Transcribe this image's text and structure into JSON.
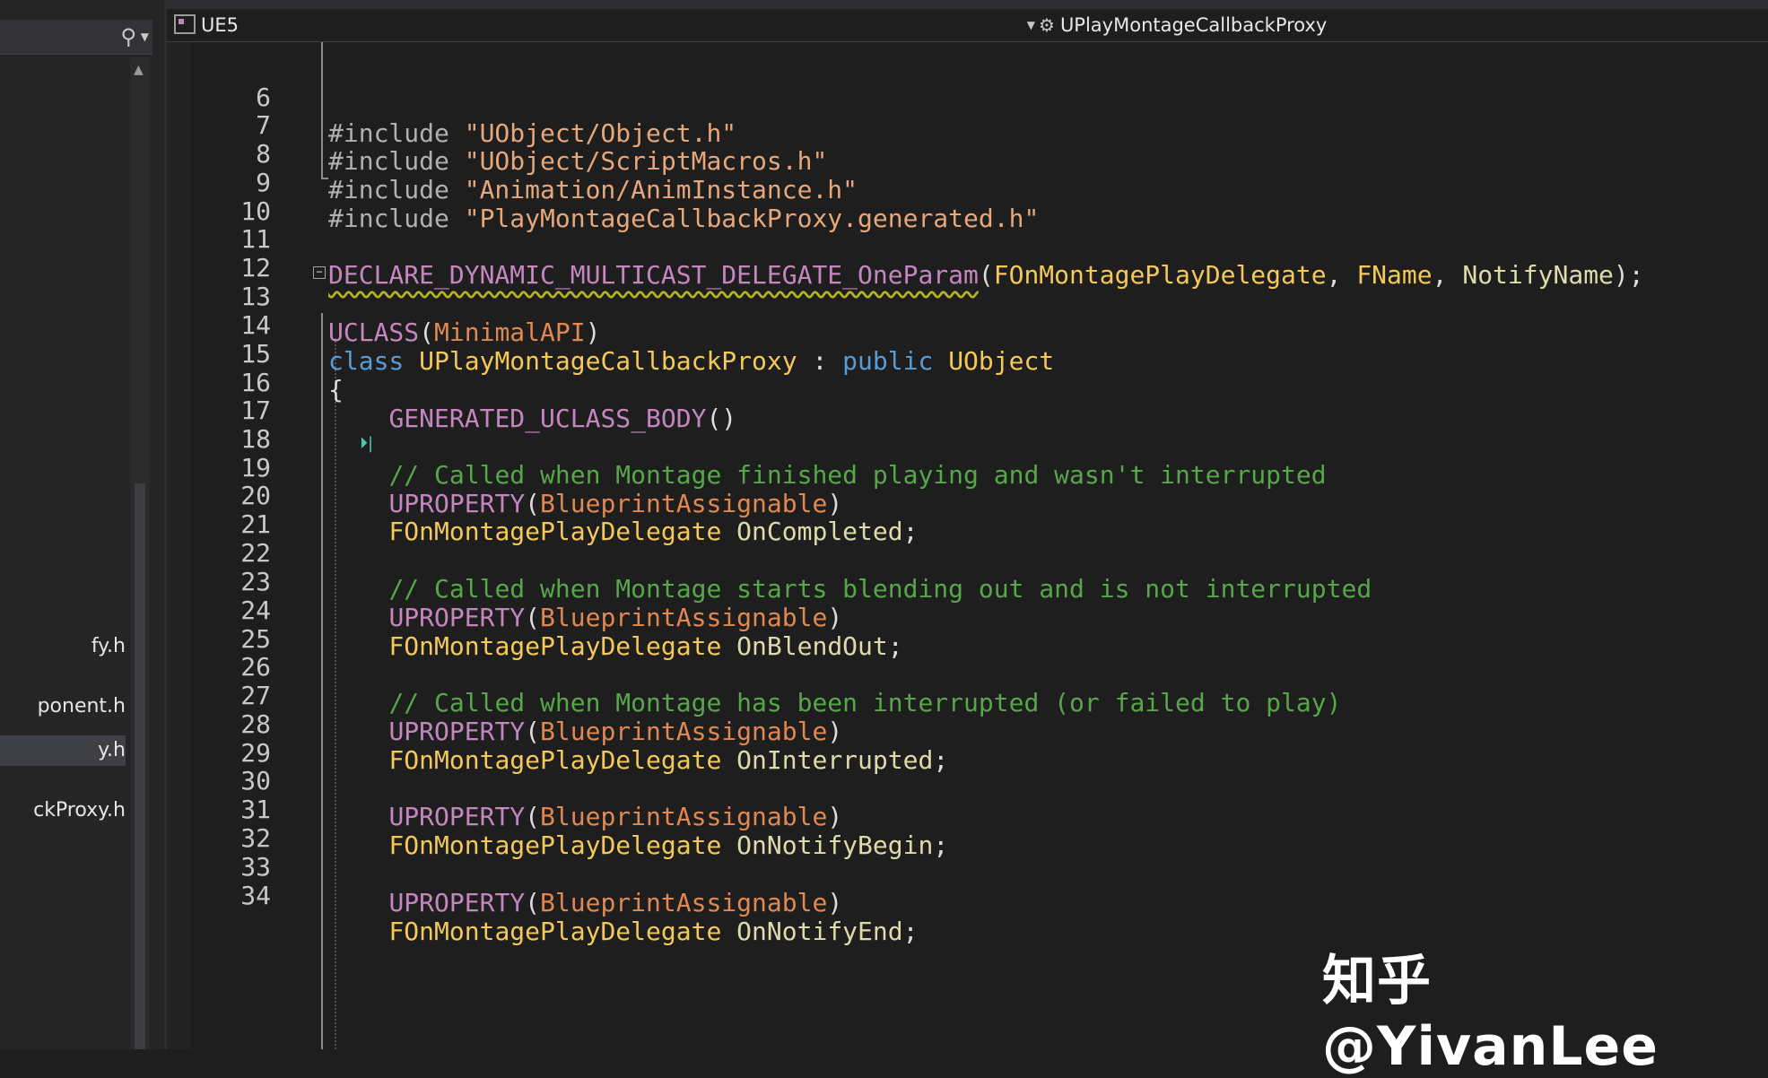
{
  "left_panel": {
    "search_icon": "search-icon",
    "files": [
      {
        "label": "fy.h",
        "selected": false
      },
      {
        "label": "ponent.h",
        "selected": false
      },
      {
        "label": "y.h",
        "selected": true
      },
      {
        "label": "ckProxy.h",
        "selected": false
      }
    ]
  },
  "nav": {
    "project": "UE5",
    "member": "UPlayMontageCallbackProxy"
  },
  "code": {
    "lines": [
      {
        "n": "6"
      },
      {
        "n": "7"
      },
      {
        "n": "8"
      },
      {
        "n": "9"
      },
      {
        "n": "10"
      },
      {
        "n": "11"
      },
      {
        "n": "12"
      },
      {
        "n": "13"
      },
      {
        "n": "14"
      },
      {
        "n": "15"
      },
      {
        "n": "16"
      },
      {
        "n": "17"
      },
      {
        "n": "18"
      },
      {
        "n": "19"
      },
      {
        "n": "20"
      },
      {
        "n": "21"
      },
      {
        "n": "22"
      },
      {
        "n": "23"
      },
      {
        "n": "24"
      },
      {
        "n": "25"
      },
      {
        "n": "26"
      },
      {
        "n": "27"
      },
      {
        "n": "28"
      },
      {
        "n": "29"
      },
      {
        "n": "30"
      },
      {
        "n": "31"
      },
      {
        "n": "32"
      },
      {
        "n": "33"
      },
      {
        "n": "34"
      }
    ],
    "t": {
      "include": "#include",
      "inc1": "\"UObject/Object.h\"",
      "inc2": "\"UObject/ScriptMacros.h\"",
      "inc3": "\"Animation/AnimInstance.h\"",
      "inc4": "\"PlayMontageCallbackProxy.generated.h\"",
      "declare": "DECLARE_DYNAMIC_MULTICAST_DELEGATE_OneParam",
      "delegate_type": "FOnMontagePlayDelegate",
      "fname": "FName",
      "notify_name": "NotifyName",
      "uclass": "UCLASS",
      "minimal_api": "MinimalAPI",
      "class_kw": "class",
      "class_name": "UPlayMontageCallbackProxy",
      "public_kw": "public",
      "uobject": "UObject",
      "open_brace": "{",
      "generated_body": "GENERATED_UCLASS_BODY",
      "comment1": "// Called when Montage finished playing and wasn't interrupted",
      "comment2": "// Called when Montage starts blending out and is not interrupted",
      "comment3": "// Called when Montage has been interrupted (or failed to play)",
      "uproperty": "UPROPERTY",
      "bp_assignable": "BlueprintAssignable",
      "on_completed": "OnCompleted",
      "on_blend_out": "OnBlendOut",
      "on_interrupted": "OnInterrupted",
      "on_notify_begin": "OnNotifyBegin",
      "on_notify_end": "OnNotifyEnd"
    }
  },
  "watermark": "知乎 @YivanLee",
  "colors": {
    "background": "#1e1e1e",
    "keyword": "#569cd6",
    "string": "#e6a77a",
    "macro": "#c586c0",
    "type": "#f5c85a",
    "comment": "#57a64a"
  }
}
